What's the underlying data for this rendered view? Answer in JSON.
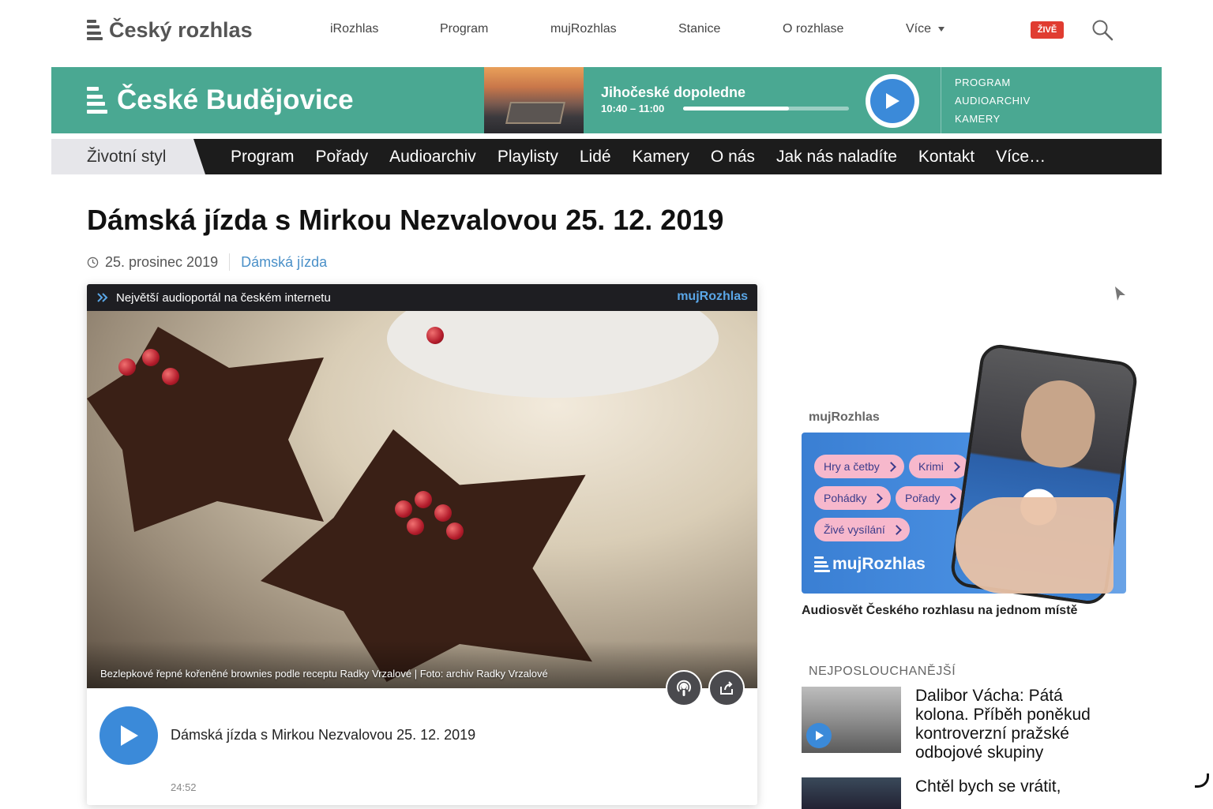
{
  "header": {
    "logo_text": "Český rozhlas",
    "nav": [
      "iRozhlas",
      "Program",
      "mujRozhlas",
      "Stanice",
      "O rozhlase",
      "Více"
    ],
    "live_badge": "ŽIVĚ",
    "search_icon": "search-icon"
  },
  "station": {
    "name": "České Budějovice",
    "current_show": "Jihočeské dopoledne",
    "time": "10:40 – 11:00",
    "progress": 0.64,
    "links": [
      "PROGRAM",
      "AUDIOARCHIV",
      "KAMERY"
    ]
  },
  "mainnav": {
    "section": "Životní styl",
    "items": [
      "Program",
      "Pořady",
      "Audioarchiv",
      "Playlisty",
      "Lidé",
      "Kamery",
      "O nás",
      "Jak nás naladíte",
      "Kontakt",
      "Více…"
    ]
  },
  "article": {
    "title": "Dámská jízda s Mirkou Nezvalovou 25. 12. 2019",
    "date": "25. prosinec 2019",
    "category": "Dámská jízda"
  },
  "player": {
    "header_text": "Největší audioportál na českém internetu",
    "brand": "mujRozhlas",
    "caption": "Bezlepkové řepné kořeněné brownies podle receptu Radky Vrzalové | Foto: archiv Radky Vrzalové",
    "episode_title": "Dámská jízda s Mirkou Nezvalovou 25. 12. 2019",
    "duration": "24:52"
  },
  "sidebar": {
    "promo_label": "mujRozhlas",
    "chips": [
      "Hry a četby",
      "Krimi",
      "Pohádky",
      "Pořady",
      "Živé vysílání"
    ],
    "promo_brand": "mujRozhlas",
    "promo_caption": "Audiosvět Českého rozhlasu na jednom místě",
    "most_listened_label": "NEJPOSLOUCHANĚJŠÍ",
    "items": [
      {
        "title": "Dalibor Vácha: Pátá kolona. Příběh poněkud kontroverzní pražské odbojové skupiny"
      },
      {
        "title": "Chtěl bych se vrátit,"
      }
    ]
  },
  "colors": {
    "station_green": "#4aa892",
    "accent_blue": "#3b8ad9",
    "live_red": "#e03c31",
    "nav_dark": "#1c1c1c"
  }
}
